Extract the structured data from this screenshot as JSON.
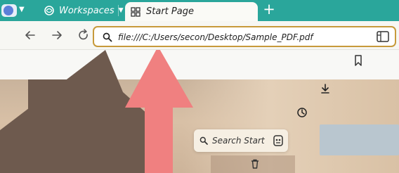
{
  "tabbar": {
    "workspaces_label": "Workspaces",
    "active_tab_title": "Start Page",
    "accent_color": "#2aa69b"
  },
  "toolbar": {
    "url_value": "file:///C:/Users/secon/Desktop/Sample_PDF.pdf"
  },
  "start_page": {
    "search_label": "Search Start"
  },
  "icons": {
    "profile": "profile-icon",
    "workspaces": "workspaces-icon",
    "tab": "tab-grid-icon",
    "back": "back-arrow-icon",
    "forward": "forward-arrow-icon",
    "reload": "reload-icon",
    "address_search": "search-icon",
    "extensions": "extensions-icon",
    "bookmark": "bookmark-icon",
    "download": "download-icon",
    "history": "history-icon",
    "ai": "ai-icon",
    "arrow": "big-up-arrow-overlay"
  },
  "colors": {
    "address_border": "#c79a3b",
    "arrow_fill": "#f08080"
  }
}
